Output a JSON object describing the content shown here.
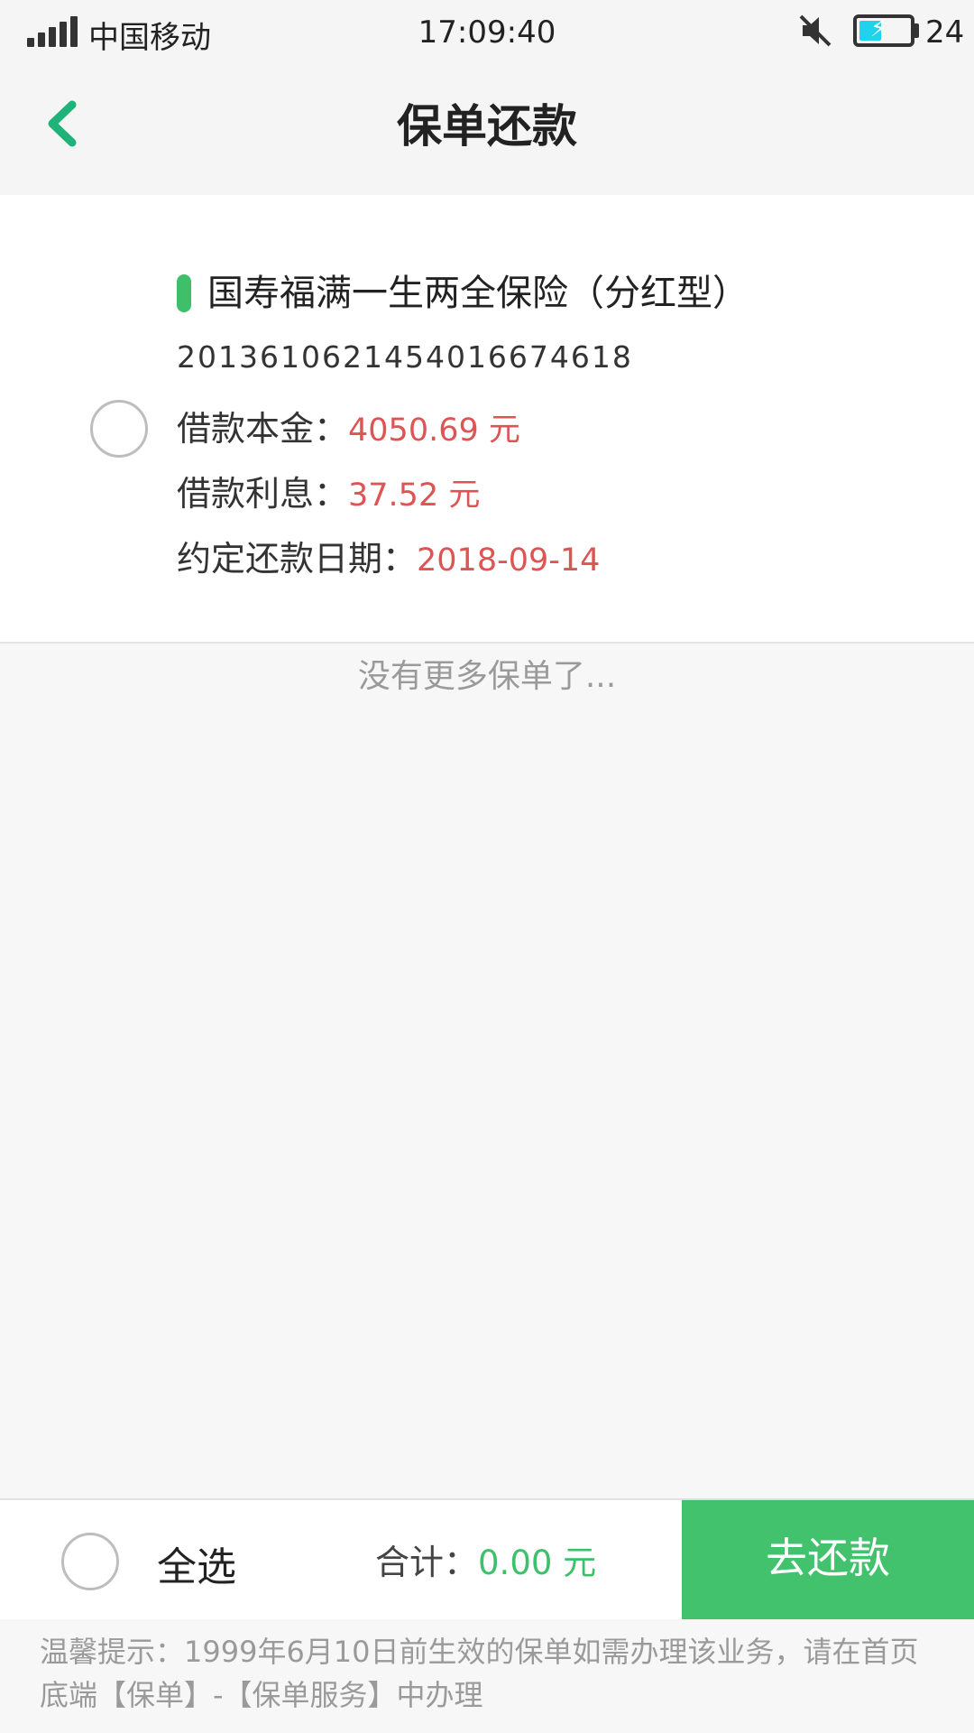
{
  "status_bar": {
    "carrier": "中国移动",
    "time": "17:09:40",
    "battery_level": "24",
    "battery_percent": 24,
    "icons": [
      "signal-icon",
      "mute-icon",
      "battery-charging-icon"
    ]
  },
  "header": {
    "title": "保单还款",
    "back_icon": "chevron-left-icon"
  },
  "policy": {
    "name": "国寿福满一生两全保险（分红型）",
    "number": "201361062145401667461 8",
    "principal_label": "借款本金：",
    "principal_value": "4050.69 元",
    "interest_label": "借款利息：",
    "interest_value": "37.52 元",
    "due_date_label": "约定还款日期：",
    "due_date_value": "2018-09-14"
  },
  "list": {
    "end_text": "没有更多保单了..."
  },
  "bottom_bar": {
    "select_all": "全选",
    "total_label": "合计：",
    "total_value": "0.00 元",
    "repay_button": "去还款"
  },
  "tip": "温馨提示：1999年6月10日前生效的保单如需办理该业务，请在首页底端【保单】-【保单服务】中办理",
  "colors": {
    "accent_green": "#43c26d",
    "value_red": "#de5454",
    "back_arrow": "#1fb37a"
  }
}
